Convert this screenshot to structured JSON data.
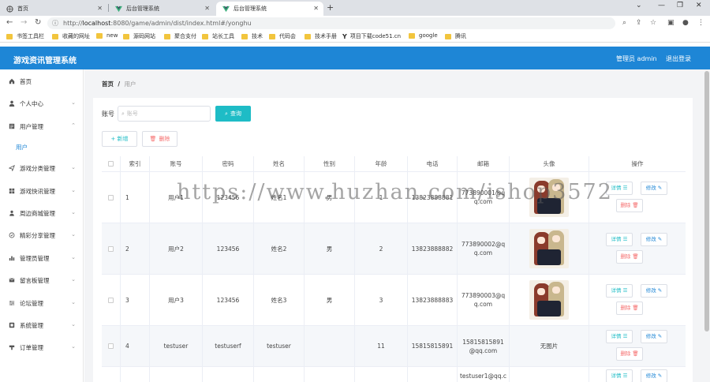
{
  "browser": {
    "tabs": [
      {
        "label": "首页",
        "active": false
      },
      {
        "label": "后台管理系统",
        "active": false
      },
      {
        "label": "后台管理系统",
        "active": true
      }
    ],
    "url_host": "localhost",
    "url_path": ":8080/game/admin/dist/index.html#/yonghu",
    "url_scheme": "http://",
    "bookmarks": [
      "书签工具栏",
      "收藏的网址",
      "new",
      "源码网站",
      "聚合支付",
      "站长工具",
      "技术",
      "代码会",
      "技术手册",
      "项目下载code51.cn",
      "google",
      "腾讯"
    ]
  },
  "header": {
    "title": "游戏资讯管理系统",
    "user": "管理员 admin",
    "logout": "退出登录",
    "color": "#1e86d6"
  },
  "sidebar": {
    "items": [
      {
        "label": "首页",
        "icon": "home-icon"
      },
      {
        "label": "个人中心",
        "icon": "user-icon"
      },
      {
        "label": "用户管理",
        "icon": "doc-icon"
      },
      {
        "label": "游戏分类管理",
        "icon": "send-icon"
      },
      {
        "label": "游戏快讯管理",
        "icon": "grid-icon"
      },
      {
        "label": "周边商城管理",
        "icon": "person-icon"
      },
      {
        "label": "精彩分享管理",
        "icon": "circle-icon"
      },
      {
        "label": "管理员管理",
        "icon": "bar-icon"
      },
      {
        "label": "留言板管理",
        "icon": "msg-icon"
      },
      {
        "label": "论坛管理",
        "icon": "sliders-icon"
      },
      {
        "label": "系统管理",
        "icon": "system-icon"
      },
      {
        "label": "订单管理",
        "icon": "order-icon"
      }
    ],
    "sub_item": "用户"
  },
  "breadcrumb": {
    "home": "首页",
    "sep": "/",
    "current": "用户"
  },
  "search": {
    "label": "账号",
    "placeholder": "账号",
    "button": "查询"
  },
  "actions": {
    "add": "+ 新增",
    "delete": "删除"
  },
  "table": {
    "headers": [
      "",
      "索引",
      "账号",
      "密码",
      "姓名",
      "性别",
      "年龄",
      "电话",
      "邮箱",
      "头像",
      "操作"
    ],
    "rows": [
      {
        "index": "1",
        "account": "用户1",
        "password": "123456",
        "name": "姓名1",
        "gender": "男",
        "age": "1",
        "phone": "13823888881",
        "email": "773890001@qq.com",
        "avatar": "image"
      },
      {
        "index": "2",
        "account": "用户2",
        "password": "123456",
        "name": "姓名2",
        "gender": "男",
        "age": "2",
        "phone": "13823888882",
        "email": "773890002@qq.com",
        "avatar": "image"
      },
      {
        "index": "3",
        "account": "用户3",
        "password": "123456",
        "name": "姓名3",
        "gender": "男",
        "age": "3",
        "phone": "13823888883",
        "email": "773890003@qq.com",
        "avatar": "image"
      },
      {
        "index": "4",
        "account": "testuser",
        "password": "testuserf",
        "name": "testuser",
        "gender": "",
        "age": "11",
        "phone": "15815815891",
        "email": "15815815891@qq.com",
        "avatar": "无图片"
      },
      {
        "index": "",
        "account": "",
        "password": "",
        "name": "",
        "gender": "",
        "age": "",
        "phone": "",
        "email": "testuser1@qq.c",
        "avatar": ""
      }
    ],
    "op": {
      "detail": "详情",
      "edit": "修改",
      "remove": "删除"
    }
  },
  "watermark": "https://www.huzhan.com/ishop3572"
}
